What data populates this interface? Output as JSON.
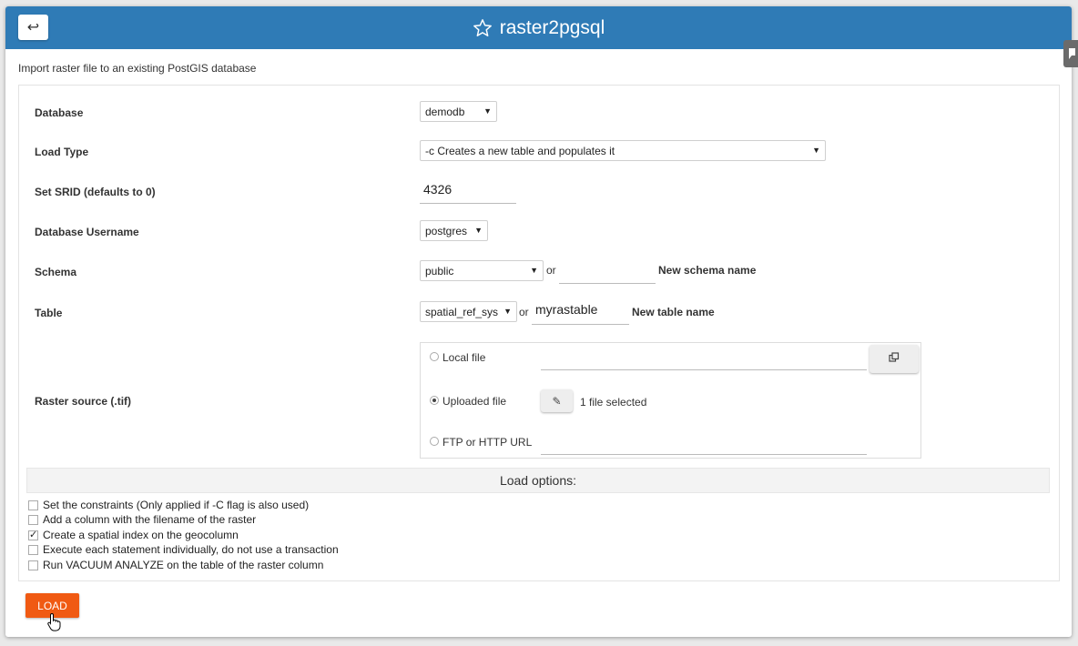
{
  "header": {
    "title": "raster2pgsql",
    "back_icon": "↩"
  },
  "intro": "Import raster file to an existing PostGIS database",
  "form": {
    "database": {
      "label": "Database",
      "value": "demodb"
    },
    "load_type": {
      "label": "Load Type",
      "value": "-c Creates a new table and populates it"
    },
    "srid": {
      "label": "Set SRID (defaults to 0)",
      "value": "4326"
    },
    "username": {
      "label": "Database Username",
      "value": "postgres"
    },
    "schema": {
      "label": "Schema",
      "value": "public",
      "or": "or",
      "new_value": "",
      "new_label": "New schema name"
    },
    "table": {
      "label": "Table",
      "value": "spatial_ref_sys",
      "or": "or",
      "new_value": "myrastable",
      "new_label": "New table name"
    },
    "raster": {
      "label": "Raster source (.tif)",
      "local_label": "Local file",
      "uploaded_label": "Uploaded file",
      "uploaded_status": "1 file selected",
      "url_label": "FTP or HTTP URL",
      "selected": "uploaded"
    }
  },
  "load_options": {
    "title": "Load options:",
    "items": [
      {
        "label": "Set the constraints (Only applied if -C flag is also used)",
        "checked": false
      },
      {
        "label": "Add a column with the filename of the raster",
        "checked": false
      },
      {
        "label": "Create a spatial index on the geocolumn",
        "checked": true
      },
      {
        "label": "Execute each statement individually, do not use a transaction",
        "checked": false
      },
      {
        "label": "Run VACUUM ANALYZE on the table of the raster column",
        "checked": false
      }
    ]
  },
  "load_button": "LOAD",
  "colors": {
    "header": "#2f7bb6",
    "load_button": "#f05a13"
  }
}
